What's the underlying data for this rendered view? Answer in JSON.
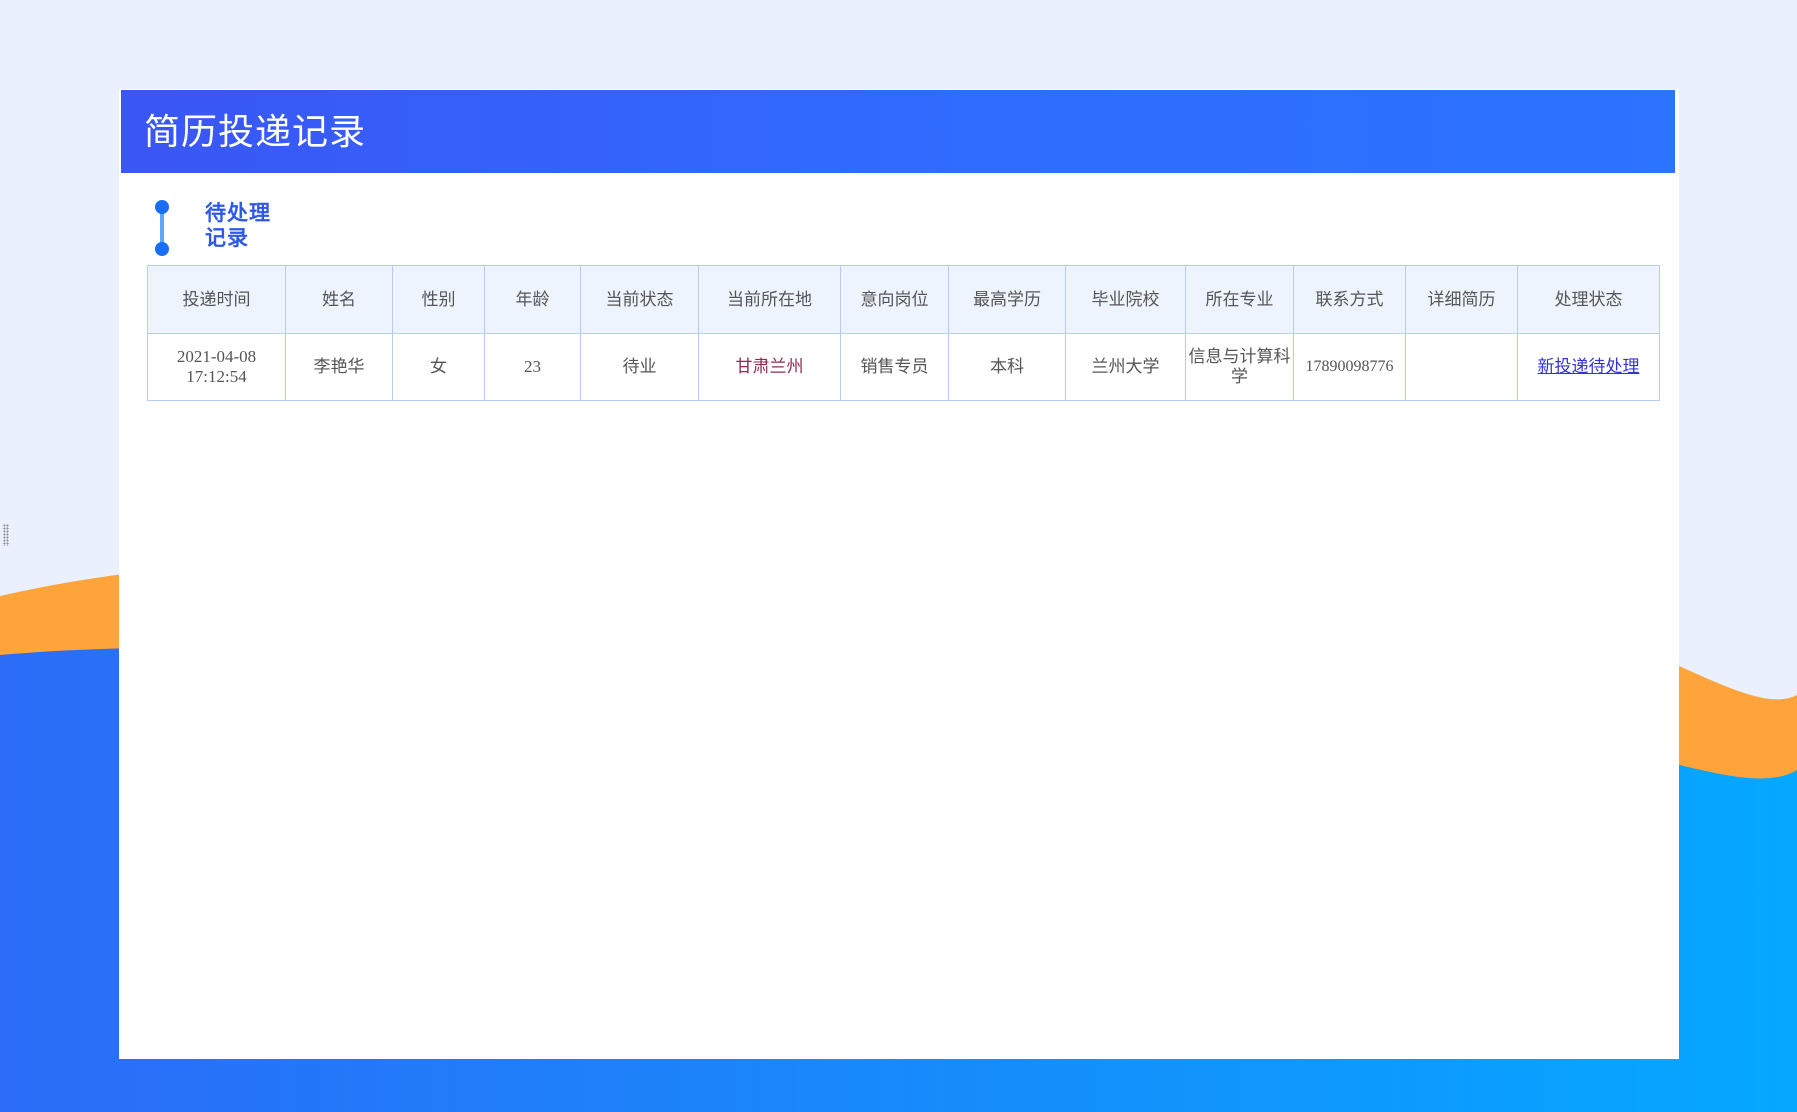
{
  "page": {
    "title": "简历投递记录",
    "section_title": "待处理记录"
  },
  "colors": {
    "header_gradient_start": "#3a56f5",
    "header_gradient_end": "#2c73ff",
    "section_title": "#2e58ea",
    "table_border": "#b5cdf0",
    "table_header_bg": "#eef4fd",
    "wave_orange": "#ffa43a",
    "wave_blue": "#1f7dff",
    "link": "#3333dd"
  },
  "table": {
    "columns": [
      "投递时间",
      "姓名",
      "性别",
      "年龄",
      "当前状态",
      "当前所在地",
      "意向岗位",
      "最高学历",
      "毕业院校",
      "所在专业",
      "联系方式",
      "详细简历",
      "处理状态"
    ],
    "rows": [
      {
        "submit_date": "2021-04-08",
        "submit_time": "17:12:54",
        "name": "李艳华",
        "gender": "女",
        "age": "23",
        "status": "待业",
        "location": "甘肃兰州",
        "position": "销售专员",
        "education": "本科",
        "school": "兰州大学",
        "major": "信息与计算科学",
        "phone": "17890098776",
        "resume": "",
        "process_status": "新投递待处理"
      }
    ]
  }
}
